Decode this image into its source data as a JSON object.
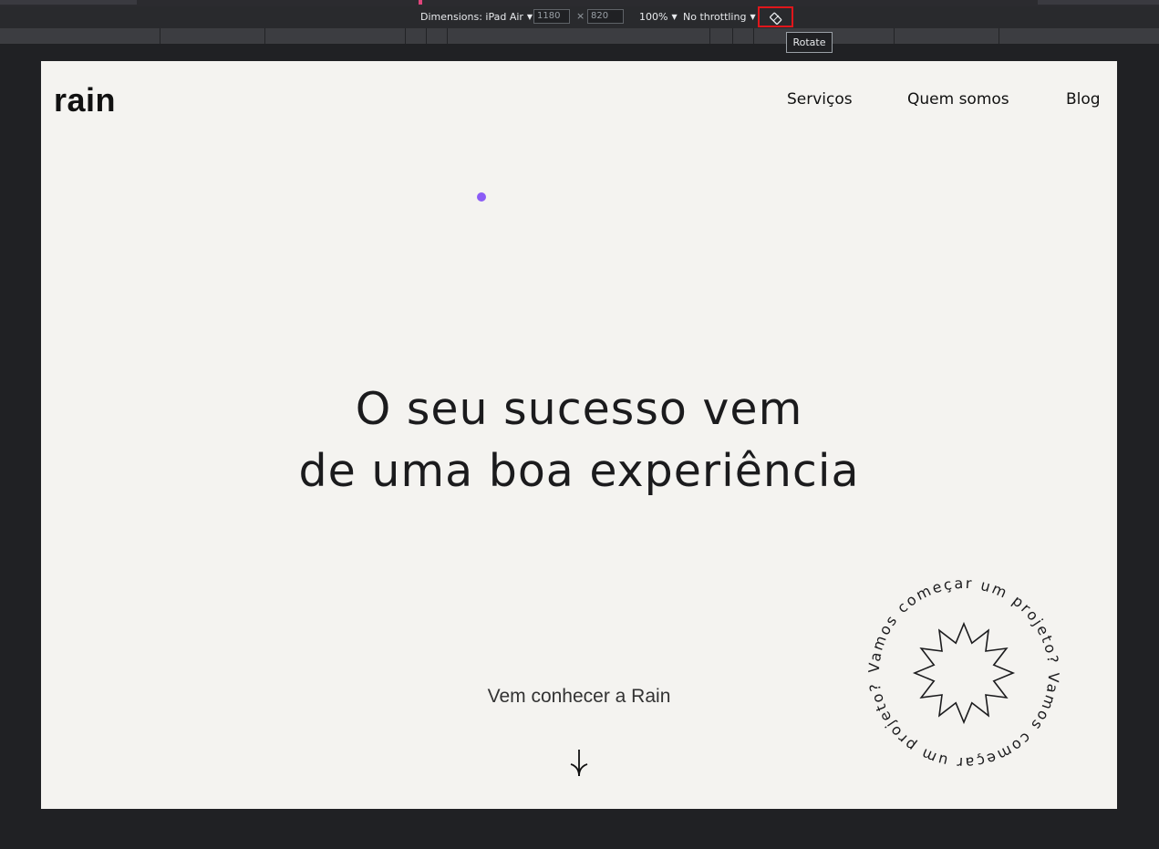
{
  "devtools": {
    "dimensions_label": "Dimensions: iPad Air",
    "width_value": "1180",
    "height_value": "820",
    "times_symbol": "×",
    "zoom": "100%",
    "throttling": "No throttling",
    "rotate_tooltip": "Rotate",
    "highlight_color": "#e0161b"
  },
  "site": {
    "logo": "rain",
    "nav": [
      "Serviços",
      "Quem somos",
      "Blog"
    ],
    "headline_line1": "O seu sucesso vem",
    "headline_line2": "de uma boa experiência",
    "subtitle": "Vem conhecer a Rain",
    "badge_text": "Vamos começar um projeto? Vamos começar um projeto?",
    "accent_color": "#8b5cf6",
    "background_color": "#f4f3f0"
  },
  "icons": {
    "rotate": "rotate-icon",
    "scroll_down": "arrow-down-icon",
    "badge_star": "star-burst-icon"
  }
}
